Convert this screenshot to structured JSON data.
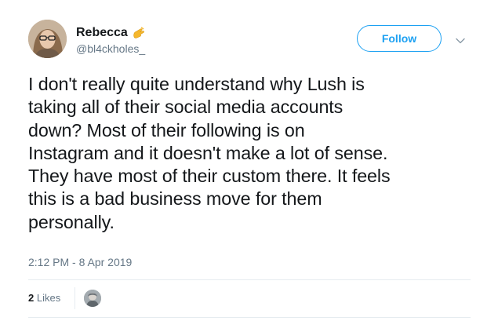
{
  "user": {
    "display_name": "Rebecca",
    "handle": "@bl4ckholes_",
    "name_emoji_icon": "pinching-hand-emoji"
  },
  "actions": {
    "follow_label": "Follow",
    "menu_icon": "chevron-down-icon"
  },
  "tweet": {
    "text_lines": [
      "I don't really quite understand why Lush is",
      "taking all of their social media accounts",
      "down? Most of their following is on",
      "Instagram and it doesn't make a lot of sense.",
      "They have most of their custom there. It feels",
      "this is a bad business move for them",
      "personally."
    ],
    "timestamp": "2:12 PM - 8 Apr 2019"
  },
  "stats": {
    "likes_count": "2",
    "likes_label": "Likes"
  },
  "colors": {
    "accent": "#1da1f2",
    "secondary_text": "#657786",
    "primary_text": "#14171a",
    "divider": "#e6ecf0"
  }
}
